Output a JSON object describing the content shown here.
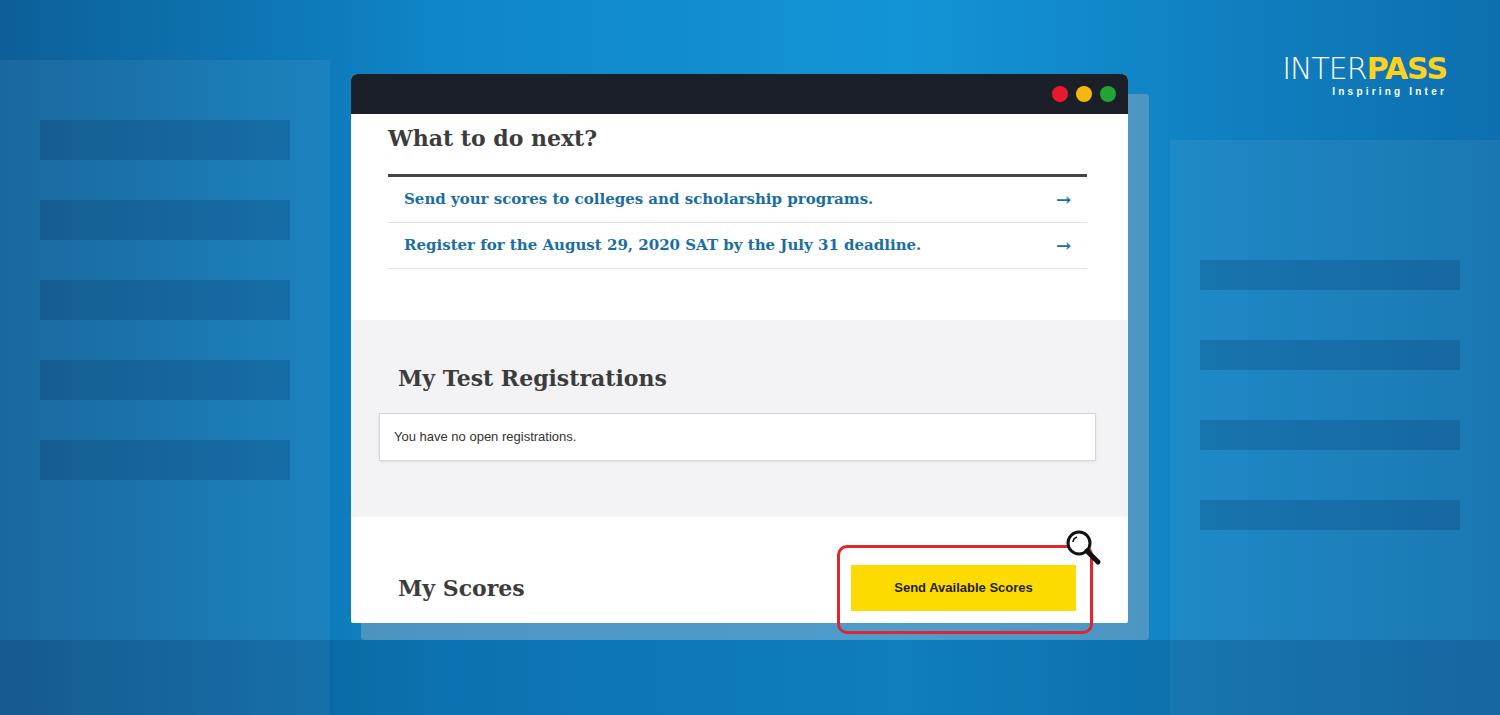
{
  "logo": {
    "primary": "INTER",
    "accent": "PASS",
    "tagline": "Inspiring Inter"
  },
  "window": {
    "controls": [
      {
        "color": "#e8192c"
      },
      {
        "color": "#f5b70f"
      },
      {
        "color": "#21a336"
      }
    ]
  },
  "next_steps": {
    "title": "What to do next?",
    "items": [
      {
        "label": "Send your scores to colleges and scholarship programs.",
        "arrow": "→"
      },
      {
        "label": "Register for the August 29, 2020 SAT by the July 31 deadline.",
        "arrow": "→"
      }
    ]
  },
  "registrations": {
    "title": "My Test Registrations",
    "message": "You have no open registrations."
  },
  "scores": {
    "title": "My Scores",
    "button": {
      "label": "Send Available Scores",
      "highlighted": true
    }
  }
}
